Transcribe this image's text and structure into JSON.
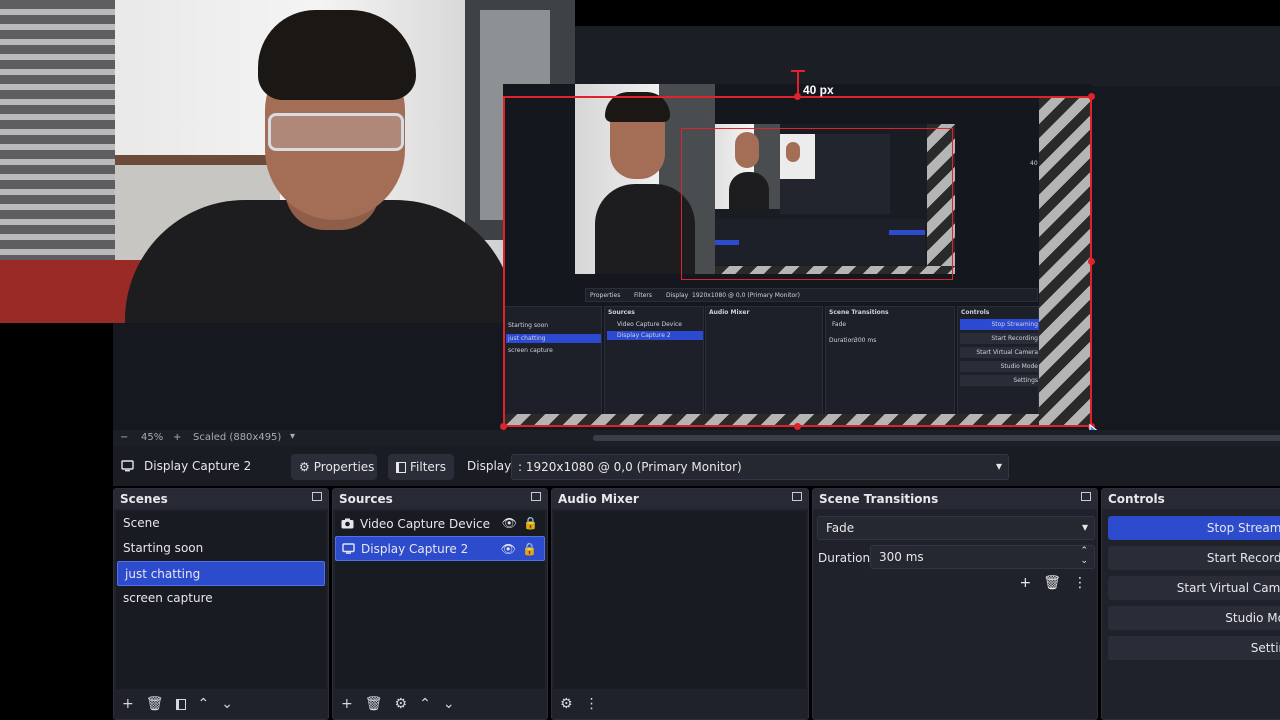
{
  "preview": {
    "offset_label": "40 px",
    "mini_offset_label": "40 px",
    "mini_scenes": [
      "Scene",
      "Starting soon",
      "just chatting",
      "screen capture"
    ],
    "mini_sources": [
      "Video Capture Device",
      "Display Capture 2"
    ],
    "mini_display": "1920x1080 @ 0,0 (Primary Monitor)",
    "mini_duration": "300 ms",
    "mini_transition": "Fade",
    "mini_controls": [
      "Stop Streaming",
      "Start Recording",
      "Start Virtual Camera",
      "Studio Mode",
      "Settings"
    ],
    "mini_properties": "Properties",
    "mini_filters": "Filters",
    "mini_display_label": "Display",
    "mini_scenes_title": "Sources",
    "mini_audio_title": "Audio Mixer",
    "mini_transitions_title": "Scene Transitions",
    "mini_controls_title": "Controls",
    "mini_duration_label": "Duration"
  },
  "zoom": {
    "minus": "−",
    "percent": "45%",
    "plus": "+",
    "scale": "Scaled (880x495)"
  },
  "source_toolbar": {
    "source_name": "Display Capture 2",
    "properties_label": "Properties",
    "filters_label": "Filters",
    "display_label": "Display",
    "display_value": ": 1920x1080 @ 0,0 (Primary Monitor)"
  },
  "scenes": {
    "title": "Scenes",
    "items": [
      {
        "label": "Scene",
        "selected": false
      },
      {
        "label": "Starting soon",
        "selected": false
      },
      {
        "label": "just chatting",
        "selected": true
      },
      {
        "label": "screen capture",
        "selected": false
      }
    ]
  },
  "sources": {
    "title": "Sources",
    "items": [
      {
        "label": "Video Capture Device",
        "icon": "camera-icon",
        "selected": false
      },
      {
        "label": "Display Capture 2",
        "icon": "monitor-icon",
        "selected": true
      }
    ]
  },
  "audio": {
    "title": "Audio Mixer"
  },
  "transitions": {
    "title": "Scene Transitions",
    "selected": "Fade",
    "duration_label": "Duration",
    "duration_value": "300 ms"
  },
  "controls": {
    "title": "Controls",
    "buttons": [
      "Stop Streaming",
      "Start Recording",
      "Start Virtual Camera",
      "Studio Mode",
      "Settings"
    ]
  },
  "colors": {
    "accent": "#2d4bcd",
    "red_outline": "#e0222a",
    "panel_bg": "#1f212b"
  }
}
